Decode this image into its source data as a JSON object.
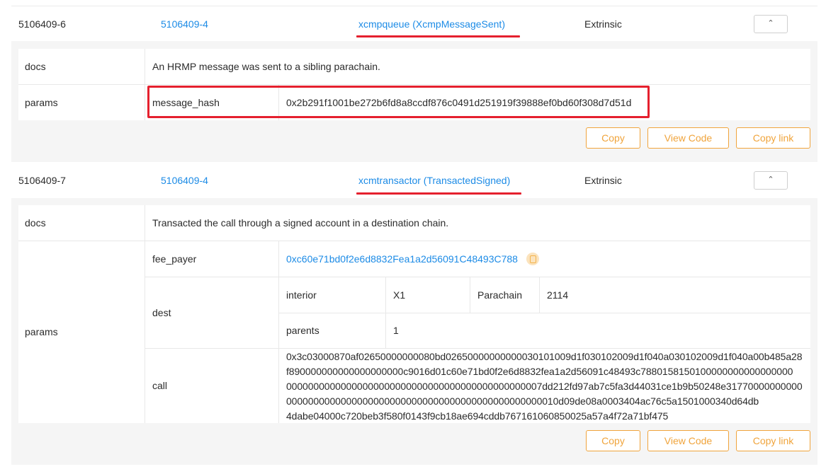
{
  "events": [
    {
      "event_id": "5106409-6",
      "extrinsic": "5106409-4",
      "module": "xcmpqueue (XcmpMessageSent)",
      "type": "Extrinsic",
      "toggle_icon": "chevron-up-icon",
      "docs_label": "docs",
      "docs": "An HRMP message was sent to a sibling parachain.",
      "params_label": "params",
      "params": {
        "message_hash_key": "message_hash",
        "message_hash_value": "0x2b291f1001be272b6fd8a8ccdf876c0491d251919f39888ef0bd60f308d7d51d"
      },
      "buttons": {
        "copy": "Copy",
        "view_code": "View Code",
        "copy_link": "Copy link"
      }
    },
    {
      "event_id": "5106409-7",
      "extrinsic": "5106409-4",
      "module": "xcmtransactor (TransactedSigned)",
      "type": "Extrinsic",
      "toggle_icon": "chevron-up-icon",
      "docs_label": "docs",
      "docs": "Transacted the call through a signed account in a destination chain.",
      "params_label": "params",
      "params": {
        "fee_payer_key": "fee_payer",
        "fee_payer_value": "0xc60e71bd0f2e6d8832Fea1a2d56091C48493C788",
        "dest_key": "dest",
        "interior_key": "interior",
        "interior_value": "X1",
        "parachain_key": "Parachain",
        "parachain_value": "2114",
        "parents_key": "parents",
        "parents_value": "1",
        "call_key": "call",
        "call_lines": [
          "0x3c03000870af02650000000080bd02650000000000030101009d1f030102009d1f040a030102009d1f040a00b485a28",
          "f890000000000000000000c9016d01c60e71bd0f2e6d8832fea1a2d56091c48493c7880158150100000000000000000",
          "00000000000000000000000000000000000000000000007dd212fd97ab7c5fa3d44031ce1b9b50248e31770000000000",
          "00000000000000000000000000000000000000000000000010d09de08a0003404ac76c5a1501000340d64db",
          "4dabe04000c720beb3f580f0143f9cb18ae694cddb767161060850025a57a4f72a71bf475"
        ]
      },
      "buttons": {
        "copy": "Copy",
        "view_code": "View Code",
        "copy_link": "Copy link"
      }
    }
  ],
  "colors": {
    "link": "#1c8be6",
    "highlight_red": "#e5202e",
    "button_orange": "#f0a43c",
    "panel_bg": "#f5f5f5"
  }
}
